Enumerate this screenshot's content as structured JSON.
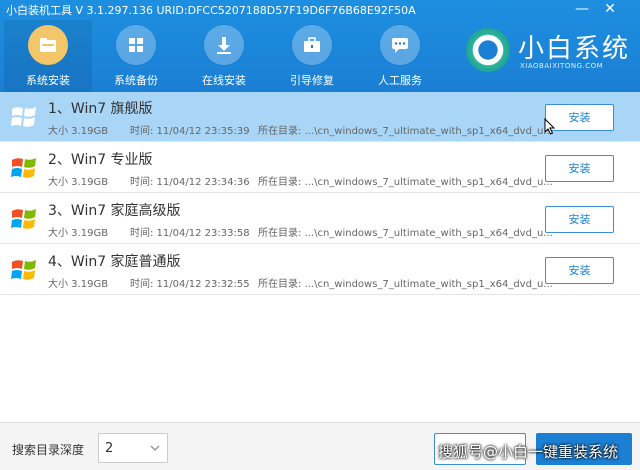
{
  "window": {
    "title": "小白装机工具 V 3.1.297.136 URID:DFCC5207188D57F19D6F76B68E92F50A",
    "minimize_glyph": "—",
    "close_glyph": "✕"
  },
  "nav": {
    "items": [
      {
        "label": "系统安装",
        "icon": "folder-icon",
        "active": true
      },
      {
        "label": "系统备份",
        "icon": "windows-icon",
        "active": false
      },
      {
        "label": "在线安装",
        "icon": "download-icon",
        "active": false
      },
      {
        "label": "引导修复",
        "icon": "toolbox-icon",
        "active": false
      },
      {
        "label": "人工服务",
        "icon": "chat-icon",
        "active": false
      }
    ]
  },
  "brand": {
    "name": "小白系统",
    "subtitle": "XIAOBAIXITONG.COM"
  },
  "systems": [
    {
      "title": "1、Win7 旗舰版",
      "size": "大小 3.19GB",
      "time": "时间: 11/04/12 23:35:39",
      "dir": "所在目录: ...\\cn_windows_7_ultimate_with_sp1_x64_dvd_u...",
      "button": "安装",
      "selected": true
    },
    {
      "title": "2、Win7 专业版",
      "size": "大小 3.19GB",
      "time": "时间: 11/04/12 23:34:36",
      "dir": "所在目录: ...\\cn_windows_7_ultimate_with_sp1_x64_dvd_u...",
      "button": "安装",
      "selected": false
    },
    {
      "title": "3、Win7 家庭高级版",
      "size": "大小 3.19GB",
      "time": "时间: 11/04/12 23:33:58",
      "dir": "所在目录: ...\\cn_windows_7_ultimate_with_sp1_x64_dvd_u...",
      "button": "安装",
      "selected": false
    },
    {
      "title": "4、Win7 家庭普通版",
      "size": "大小 3.19GB",
      "time": "时间: 11/04/12 23:32:55",
      "dir": "所在目录: ...\\cn_windows_7_ultimate_with_sp1_x64_dvd_u...",
      "button": "安装",
      "selected": false
    }
  ],
  "footer": {
    "depth_label": "搜索目录深度",
    "depth_value": "2",
    "watermark": "搜狐号@小白一键重装系统"
  },
  "colors": {
    "header": "#1b7fd4",
    "selected_row": "#a9d5f7",
    "accent": "#3a8edb",
    "active_icon": "#f4c66a"
  }
}
